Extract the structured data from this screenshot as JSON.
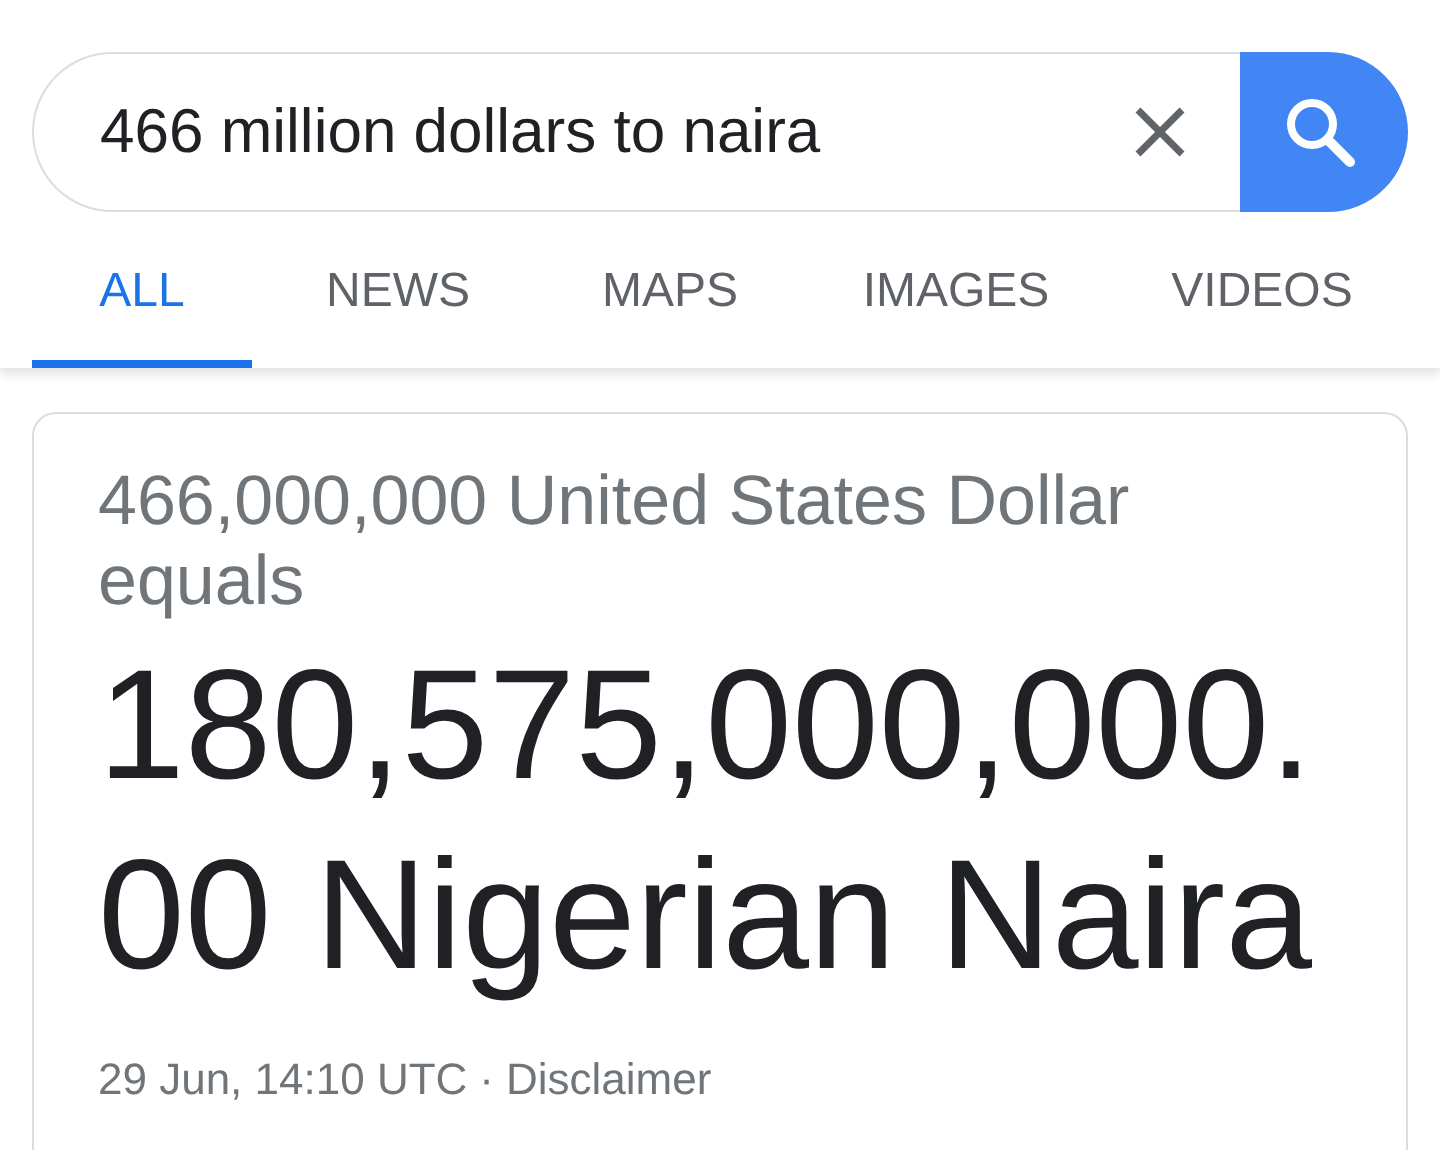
{
  "search": {
    "value": "466 million dollars to naira"
  },
  "tabs": [
    {
      "label": "ALL",
      "selected": true
    },
    {
      "label": "NEWS",
      "selected": false
    },
    {
      "label": "MAPS",
      "selected": false
    },
    {
      "label": "IMAGES",
      "selected": false
    },
    {
      "label": "VIDEOS",
      "selected": false
    }
  ],
  "result": {
    "from": "466,000,000 United States Dollar equals",
    "to": "180,575,000,000.00 Nigerian Naira",
    "timestamp": "29 Jun, 14:10 UTC",
    "separator": "·",
    "link": "Disclaimer"
  }
}
